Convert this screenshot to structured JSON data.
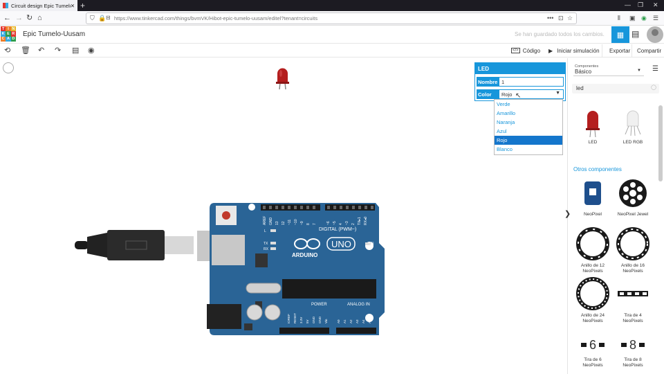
{
  "browser": {
    "tab_title": "Circuit design Epic Tumelo-Uus",
    "tab_close": "✕",
    "new_tab": "+",
    "url": "https://www.tinkercad.com/things/bvmVK/Hibot-epic-tumelo-uusam/editel?tenant=circuits",
    "icons": [
      "back-icon",
      "forward-icon",
      "reload-icon",
      "home-icon",
      "shield-icon",
      "lock-icon",
      "bookmark-icon",
      "library-icon",
      "sidebar-icon",
      "extension-icon",
      "menu-icon"
    ]
  },
  "app": {
    "logo_letters": [
      "TIN",
      "KER",
      "CAD"
    ],
    "project_name": "Epic Tumelo-Uusam",
    "save_status": "Se han guardado todos los cambios."
  },
  "toolbar": {
    "code": "Código",
    "simulate": "Iniciar simulación",
    "export": "Exportar",
    "share": "Compartir"
  },
  "inspector": {
    "title": "LED",
    "name_label": "Nombre",
    "name_value": "1",
    "color_label": "Color",
    "color_value": "Rojo",
    "color_options": [
      "Verde",
      "Amarillo",
      "Naranja",
      "Azul",
      "Rojo",
      "Blanco"
    ],
    "selected_index": 4
  },
  "sidebar": {
    "category_label": "Componentes",
    "category_value": "Básico",
    "search_value": "led",
    "section_other": "Otros componentes",
    "components": [
      "LED",
      "LED RGB"
    ],
    "other_components": [
      "NeoPixel",
      "NeoPixel Jewel",
      "Anillo de 12 NeoPixels",
      "Anillo de 16 NeoPixels",
      "Anillo de 24 NeoPixels",
      "Tira de 4 NeoPixels",
      "Tira de 6 NeoPixels",
      "Tira de 8 NeoPixels"
    ],
    "strip_digits": [
      "6",
      "8"
    ]
  },
  "board": {
    "brand": "ARDUINO",
    "model": "UNO",
    "digital_label": "DIGITAL (PWM~)",
    "power_label": "POWER",
    "analog_label": "ANALOG IN",
    "on_label": "ON",
    "led_labels": [
      "L",
      "TX",
      "RX"
    ],
    "digital_pins": [
      "AREF",
      "GND",
      "13",
      "12",
      "~11",
      "~10",
      "~9",
      "8",
      "7",
      "~6",
      "~5",
      "4",
      "~3",
      "2",
      "TX▸1",
      "RX◂0"
    ],
    "power_pins": [
      "IOREF",
      "RESET",
      "3.3V",
      "5V",
      "GND",
      "GND",
      "Vin"
    ],
    "analog_pins": [
      "A0",
      "A1",
      "A2",
      "A3",
      "A4",
      "A5"
    ]
  },
  "colors": {
    "accent": "#1796db",
    "board": "#2a6496",
    "led_red": "#b41e1e"
  }
}
